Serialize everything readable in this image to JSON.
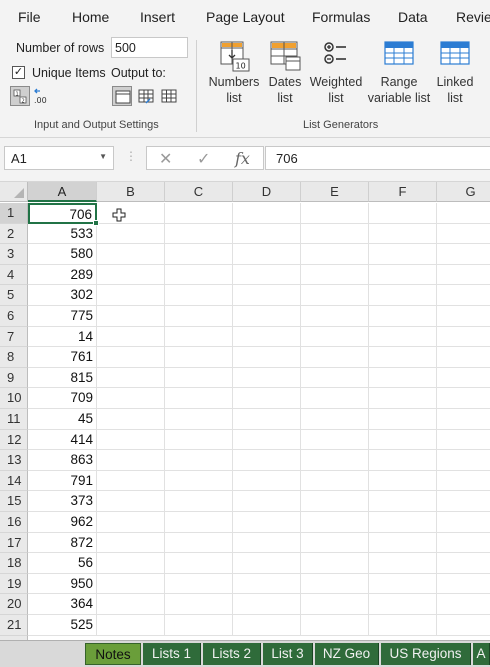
{
  "menu": {
    "tabs": [
      "File",
      "Home",
      "Insert",
      "Page Layout",
      "Formulas",
      "Data",
      "Revie"
    ]
  },
  "ribbon": {
    "rows_label": "Number of rows",
    "rows_value": "500",
    "unique_label": "Unique Items",
    "unique_checked": true,
    "output_label": "Output to:",
    "group1_label": "Input and Output Settings",
    "group2_label": "List Generators",
    "numbers_btn": {
      "line1": "Numbers",
      "line2": "list",
      "icon_text": "10"
    },
    "dates_btn": {
      "line1": "Dates",
      "line2": "list"
    },
    "weighted_btn": {
      "line1": "Weighted",
      "line2": "list"
    },
    "range_btn": {
      "line1": "Range",
      "line2": "variable list"
    },
    "linked_btn": {
      "line1": "Linked",
      "line2": "list"
    },
    "decimal_icon_text": ".00"
  },
  "formula_bar": {
    "name_box": "A1",
    "fx": "fx",
    "cancel": "✕",
    "enter": "✓",
    "value": "706"
  },
  "grid": {
    "columns": [
      "A",
      "B",
      "C",
      "D",
      "E",
      "F",
      "G"
    ],
    "rows": [
      "1",
      "2",
      "3",
      "4",
      "5",
      "6",
      "7",
      "8",
      "9",
      "10",
      "11",
      "12",
      "13",
      "14",
      "15",
      "16",
      "17",
      "18",
      "19",
      "20",
      "21"
    ],
    "values_a": [
      "706",
      "533",
      "580",
      "289",
      "302",
      "775",
      "14",
      "761",
      "815",
      "709",
      "45",
      "414",
      "863",
      "791",
      "373",
      "962",
      "872",
      "56",
      "950",
      "364",
      "525"
    ],
    "active_cell": "A1"
  },
  "sheets": [
    "Notes",
    "Lists 1",
    "Lists 2",
    "List 3",
    "NZ Geo",
    "US Regions",
    "A"
  ],
  "active_sheet": "Notes",
  "colors": {
    "accent_green": "#217346",
    "sheet_tab": "#2f6b3a",
    "sheet_active": "#6a9e3a",
    "icon_blue": "#2b7cd3",
    "icon_orange": "#f0a030"
  }
}
